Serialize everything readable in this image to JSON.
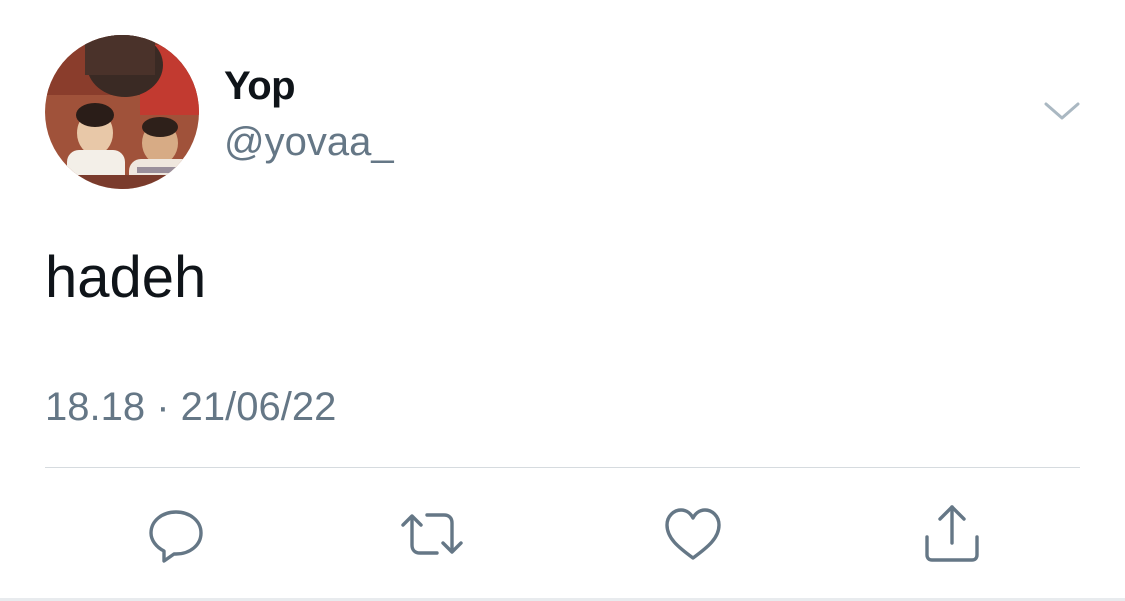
{
  "tweet": {
    "display_name": "Yop",
    "handle": "@yovaa_",
    "text": "hadeh",
    "timestamp": "18.18 · 21/06/22"
  },
  "icons": {
    "menu": "chevron-down-icon",
    "reply": "reply-icon",
    "retweet": "retweet-icon",
    "like": "heart-icon",
    "share": "share-icon"
  },
  "colors": {
    "text_primary": "#0f1419",
    "text_secondary": "#657786",
    "icon_color": "#657786",
    "divider": "#d6dbdf"
  }
}
